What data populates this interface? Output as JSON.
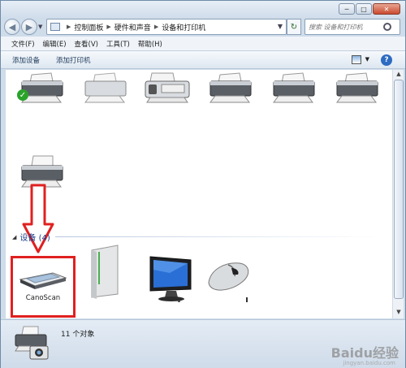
{
  "window": {
    "minimize": "─",
    "maximize": "□",
    "close": "✕"
  },
  "address": {
    "crumbs": [
      "控制面板",
      "硬件和声音",
      "设备和打印机"
    ]
  },
  "search": {
    "placeholder": "搜索 设备和打印机"
  },
  "menu": [
    "文件(F)",
    "编辑(E)",
    "查看(V)",
    "工具(T)",
    "帮助(H)"
  ],
  "toolbar": {
    "add_device": "添加设备",
    "add_printer": "添加打印机"
  },
  "group": {
    "title": "设备 (4)"
  },
  "devices": {
    "scanner_label": "CanoScan"
  },
  "status": {
    "count_text": "11 个对象"
  },
  "watermark": {
    "text": "Baidu经验",
    "sub": "jingyan.baidu.com"
  },
  "colors": {
    "highlight": "#e02020",
    "group_title": "#1e3c8c"
  }
}
